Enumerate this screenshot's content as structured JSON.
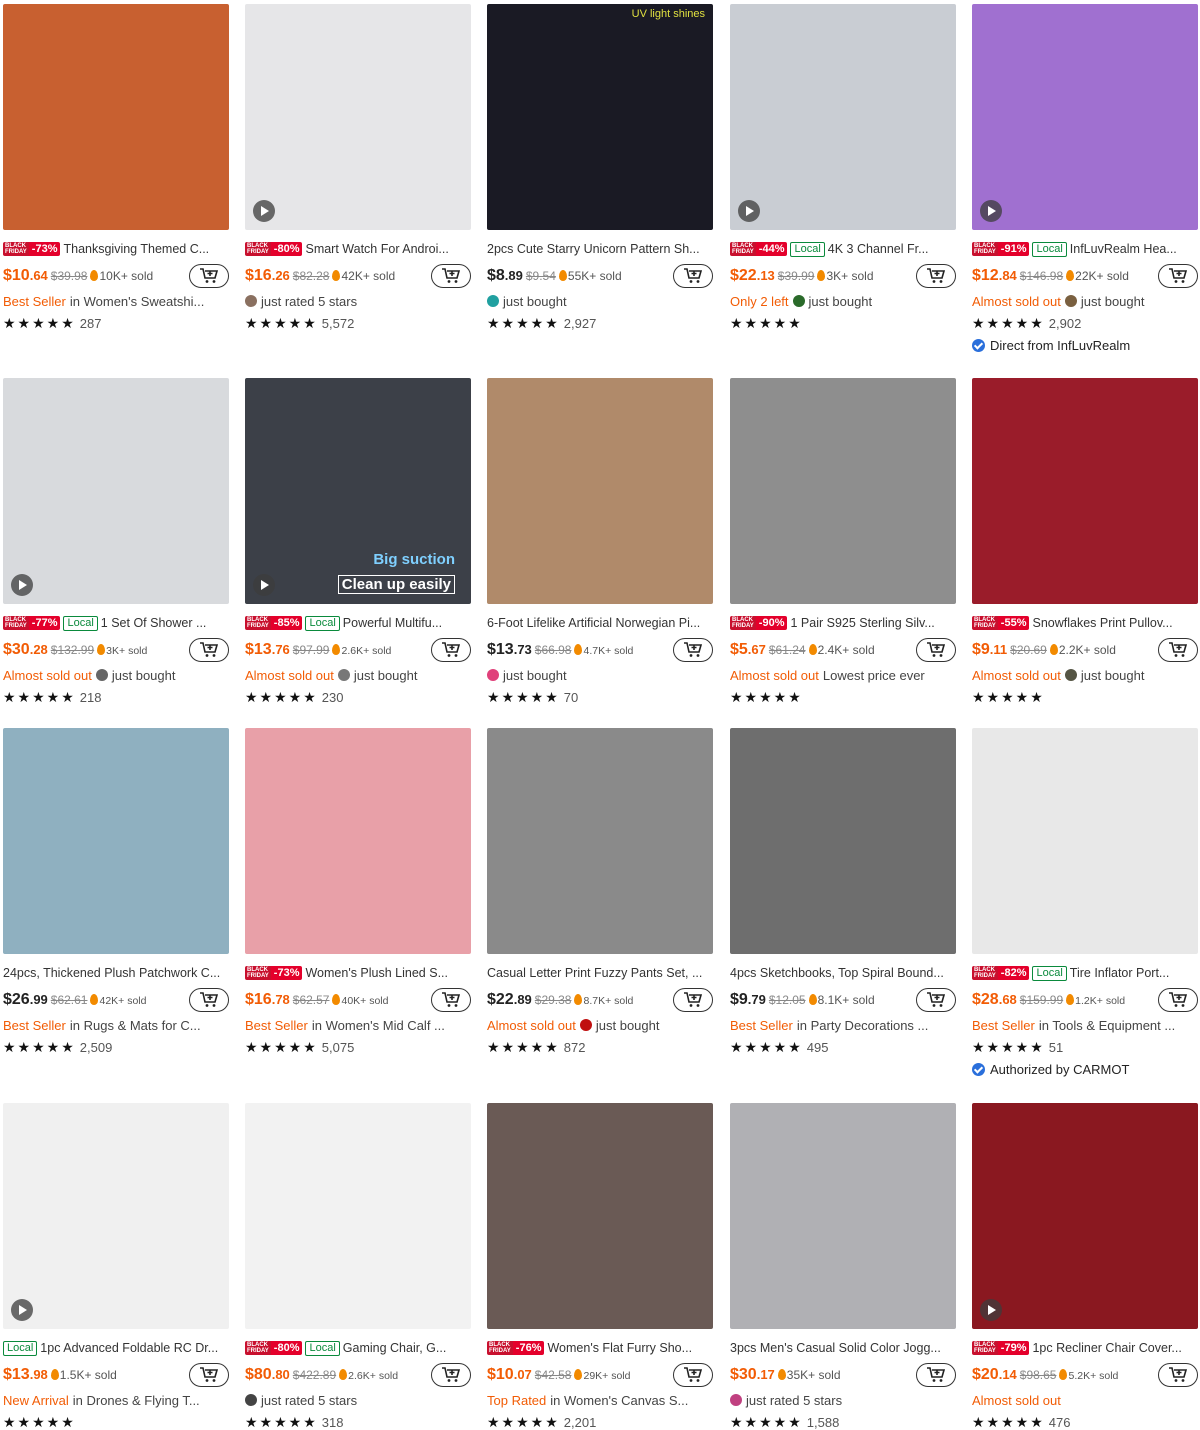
{
  "cart_icon": "add-to-cart-icon",
  "colors": {
    "accent": "#f25c05",
    "black_friday": "#e4002b",
    "local": "#0a8a3c"
  },
  "black_friday_label": [
    "BLACK",
    "FRIDAY"
  ],
  "products": [
    {
      "title": "Thanksgiving Themed C...",
      "discount": "-73%",
      "local": false,
      "price": [
        "$10",
        ".64"
      ],
      "price_orange": true,
      "orig": "$39.98",
      "sold": "10K+ sold",
      "meta": [
        {
          "t": "Best Seller",
          "o": true
        },
        {
          "t": " in Women's Sweatshi..."
        }
      ],
      "stars": "★★★★★",
      "rating_count": "287",
      "thumb": "#c86030",
      "video": false
    },
    {
      "title": "Smart Watch For Androi...",
      "discount": "-80%",
      "local": false,
      "price": [
        "$16",
        ".26"
      ],
      "price_orange": true,
      "orig": "$82.28",
      "sold": "42K+ sold",
      "meta": [
        {
          "t": "just rated 5 stars",
          "dot": "#8a7060"
        }
      ],
      "stars": "★★★★★",
      "rating_count": "5,572",
      "thumb": "#e6e6e8",
      "video": true
    },
    {
      "title": "2pcs Cute Starry Unicorn Pattern Sh...",
      "discount": null,
      "local": false,
      "price": [
        "$8",
        ".89"
      ],
      "price_orange": false,
      "orig": "$9.54",
      "sold": "55K+ sold",
      "meta": [
        {
          "t": "just bought",
          "dot": "#20a0a0"
        }
      ],
      "stars": "★★★★★",
      "rating_count": "2,927",
      "thumb": "#1a1a24",
      "video": false,
      "caption": "UV light shines"
    },
    {
      "title": "4K 3 Channel Fr...",
      "discount": "-44%",
      "local": true,
      "price": [
        "$22",
        ".13"
      ],
      "price_orange": true,
      "orig": "$39.99",
      "sold": "3K+ sold",
      "meta": [
        {
          "t": "Only 2 left",
          "o": true
        },
        {
          "t": "just bought",
          "dot": "#2a6a2a"
        }
      ],
      "stars": "★★★★★",
      "rating_count": "",
      "thumb": "#c9cdd3",
      "video": true
    },
    {
      "title": "InfLuvRealm Hea...",
      "discount": "-91%",
      "local": true,
      "price": [
        "$12",
        ".84"
      ],
      "price_orange": true,
      "orig": "$146.98",
      "sold": "22K+ sold",
      "meta": [
        {
          "t": "Almost sold out",
          "o": true
        },
        {
          "t": "just bought",
          "dot": "#7a6040"
        }
      ],
      "stars": "★★★★★",
      "rating_count": "2,902",
      "thumb": "#a070d0",
      "video": true,
      "direct": "Direct from InfLuvRealm"
    },
    {
      "title": "1 Set Of Shower ...",
      "discount": "-77%",
      "local": true,
      "price": [
        "$30",
        ".28"
      ],
      "price_orange": true,
      "orig": "$132.99",
      "sold": "3K+ sold",
      "sold_small": true,
      "meta": [
        {
          "t": "Almost sold out",
          "o": true
        },
        {
          "t": "just bought",
          "dot": "#666"
        }
      ],
      "stars": "★★★★★",
      "rating_count": "218",
      "thumb": "#d8dadd",
      "video": true
    },
    {
      "title": "Powerful Multifu...",
      "discount": "-85%",
      "local": true,
      "price": [
        "$13",
        ".76"
      ],
      "price_orange": true,
      "orig": "$97.99",
      "sold": "2.6K+ sold",
      "sold_small": true,
      "meta": [
        {
          "t": "Almost sold out",
          "o": true
        },
        {
          "t": "just bought",
          "dot": "#777"
        }
      ],
      "stars": "★★★★★",
      "rating_count": "230",
      "thumb": "#3c4048",
      "video": true,
      "caption2": [
        "Big suction",
        "Clean up easily"
      ]
    },
    {
      "title": "6-Foot Lifelike Artificial Norwegian Pi...",
      "discount": null,
      "local": false,
      "price": [
        "$13",
        ".73"
      ],
      "price_orange": false,
      "orig": "$66.98",
      "sold": "4.7K+ sold",
      "sold_small": true,
      "meta": [
        {
          "t": "just bought",
          "dot": "#e0407a"
        }
      ],
      "stars": "★★★★★",
      "rating_count": "70",
      "thumb": "#b08a6a",
      "video": false
    },
    {
      "title": "1 Pair S925 Sterling Silv...",
      "discount": "-90%",
      "local": false,
      "price": [
        "$5",
        ".67"
      ],
      "price_orange": true,
      "orig": "$61.24",
      "sold": "2.4K+ sold",
      "meta": [
        {
          "t": "Almost sold out",
          "o": true
        },
        {
          "t": "Lowest price ever"
        }
      ],
      "stars": "★★★★★",
      "rating_count": "",
      "thumb": "#8e8e8e",
      "video": false
    },
    {
      "title": "Snowflakes Print Pullov...",
      "discount": "-55%",
      "local": false,
      "price": [
        "$9",
        ".11"
      ],
      "price_orange": true,
      "orig": "$20.69",
      "sold": "2.2K+ sold",
      "meta": [
        {
          "t": "Almost sold out",
          "o": true
        },
        {
          "t": "just bought",
          "dot": "#554"
        }
      ],
      "stars": "★★★★★",
      "rating_count": "",
      "thumb": "#9a1c2a",
      "video": false
    },
    {
      "title": "24pcs, Thickened Plush Patchwork C...",
      "discount": null,
      "local": false,
      "price": [
        "$26",
        ".99"
      ],
      "price_orange": false,
      "orig": "$62.61",
      "sold": "42K+ sold",
      "sold_small": true,
      "meta": [
        {
          "t": "Best Seller",
          "o": true
        },
        {
          "t": " in Rugs & Mats for C..."
        }
      ],
      "stars": "★★★★★",
      "rating_count": "2,509",
      "thumb": "#8fb0c0",
      "video": false
    },
    {
      "title": "Women's Plush Lined S...",
      "discount": "-73%",
      "local": false,
      "price": [
        "$16",
        ".78"
      ],
      "price_orange": true,
      "orig": "$62.57",
      "sold": "40K+ sold",
      "sold_small": true,
      "meta": [
        {
          "t": "Best Seller",
          "o": true
        },
        {
          "t": " in Women's Mid Calf ..."
        }
      ],
      "stars": "★★★★★",
      "rating_count": "5,075",
      "thumb": "#e8a0a8",
      "video": false
    },
    {
      "title": "Casual Letter Print Fuzzy Pants Set, ...",
      "discount": null,
      "local": false,
      "price": [
        "$22",
        ".89"
      ],
      "price_orange": false,
      "orig": "$29.38",
      "sold": "8.7K+ sold",
      "sold_small": true,
      "meta": [
        {
          "t": "Almost sold out",
          "o": true
        },
        {
          "t": "just bought",
          "dot": "#c01010"
        }
      ],
      "stars": "★★★★★",
      "rating_count": "872",
      "thumb": "#8a8a8a",
      "video": false
    },
    {
      "title": "4pcs Sketchbooks, Top Spiral Bound...",
      "discount": null,
      "local": false,
      "price": [
        "$9",
        ".79"
      ],
      "price_orange": false,
      "orig": "$12.05",
      "sold": "8.1K+ sold",
      "meta": [
        {
          "t": "Best Seller",
          "o": true
        },
        {
          "t": " in Party Decorations ..."
        }
      ],
      "stars": "★★★★★",
      "rating_count": "495",
      "thumb": "#6e6e6e",
      "video": false
    },
    {
      "title": "Tire Inflator Port...",
      "discount": "-82%",
      "local": true,
      "price": [
        "$28",
        ".68"
      ],
      "price_orange": true,
      "orig": "$159.99",
      "sold": "1.2K+ sold",
      "sold_small": true,
      "meta": [
        {
          "t": "Best Seller",
          "o": true
        },
        {
          "t": " in Tools & Equipment ..."
        }
      ],
      "stars": "★★★★★",
      "rating_count": "51",
      "thumb": "#e8e8e8",
      "video": false,
      "direct": "Authorized by CARMOT"
    },
    {
      "title": "1pc Advanced Foldable RC Dr...",
      "discount": null,
      "local": true,
      "price": [
        "$13",
        ".98"
      ],
      "price_orange": true,
      "orig": "",
      "sold": "1.5K+ sold",
      "meta": [
        {
          "t": "New Arrival",
          "o": true
        },
        {
          "t": " in Drones & Flying T..."
        }
      ],
      "stars": "★★★★★",
      "rating_count": "",
      "thumb": "#f0f0f0",
      "video": true
    },
    {
      "title": "Gaming Chair, G...",
      "discount": "-80%",
      "local": true,
      "price": [
        "$80",
        ".80"
      ],
      "price_orange": true,
      "orig": "$422.89",
      "sold": "2.6K+ sold",
      "sold_small": true,
      "meta": [
        {
          "t": "just rated 5 stars",
          "dot": "#444"
        }
      ],
      "stars": "★★★★★",
      "rating_count": "318",
      "thumb": "#f2f2f2",
      "video": false
    },
    {
      "title": "Women's Flat Furry Sho...",
      "discount": "-76%",
      "local": false,
      "price": [
        "$10",
        ".07"
      ],
      "price_orange": true,
      "orig": "$42.58",
      "sold": "29K+ sold",
      "sold_small": true,
      "meta": [
        {
          "t": "Top Rated",
          "o": true
        },
        {
          "t": " in Women's Canvas S..."
        }
      ],
      "stars": "★★★★★",
      "rating_count": "2,201",
      "thumb": "#6a5a55",
      "video": false
    },
    {
      "title": "3pcs Men's Casual Solid Color Jogg...",
      "discount": null,
      "local": false,
      "price": [
        "$30",
        ".17"
      ],
      "price_orange": true,
      "orig": "",
      "sold": "35K+ sold",
      "meta": [
        {
          "t": "just rated 5 stars",
          "dot": "#c04080"
        }
      ],
      "stars": "★★★★★",
      "rating_count": "1,588",
      "thumb": "#b0b0b4",
      "video": false
    },
    {
      "title": "1pc Recliner Chair Cover...",
      "discount": "-79%",
      "local": false,
      "price": [
        "$20",
        ".14"
      ],
      "price_orange": true,
      "orig": "$98.65",
      "sold": "5.2K+ sold",
      "sold_small": true,
      "meta": [
        {
          "t": "Almost sold out",
          "o": true
        }
      ],
      "stars": "★★★★★",
      "rating_count": "476",
      "thumb": "#8a1820",
      "video": true
    }
  ]
}
